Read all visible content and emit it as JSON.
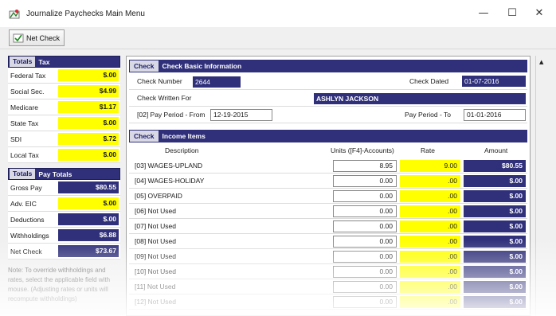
{
  "window": {
    "title": "Journalize Paychecks Main Menu",
    "minimize": "—",
    "maximize": "☐",
    "close": "✕"
  },
  "toolbar": {
    "net_check_label": "Net Check"
  },
  "sidebar": {
    "tax_tab": "Totals",
    "tax_title": "Tax",
    "taxes": [
      {
        "name": "Federal Tax",
        "value": "$.00"
      },
      {
        "name": "Social Sec.",
        "value": "$4.99"
      },
      {
        "name": "Medicare",
        "value": "$1.17"
      },
      {
        "name": "State Tax",
        "value": "$.00"
      },
      {
        "name": "SDI",
        "value": "$.72"
      },
      {
        "name": "Local Tax",
        "value": "$.00"
      }
    ],
    "pay_tab": "Totals",
    "pay_title": "Pay Totals",
    "pay": [
      {
        "name": "Gross Pay",
        "value": "$80.55"
      },
      {
        "name": "Adv. EIC",
        "value": "$.00"
      },
      {
        "name": "Deductions",
        "value": "$.00"
      },
      {
        "name": "Withholdings",
        "value": "$6.88"
      },
      {
        "name": "Net Check",
        "value": "$73.67"
      }
    ],
    "note": "Note: To override withholdings and rates, select the applicable field with mouse. (Adjusting rates or units will recompute withholdings)"
  },
  "check_info": {
    "tab": "Check",
    "title": "Check Basic Information",
    "check_number_label": "Check Number",
    "check_number": "2644",
    "check_dated_label": "Check Dated",
    "check_dated": "01-07-2016",
    "written_for_label": "Check Written For",
    "written_for": "ASHLYN JACKSON",
    "pay_from_label": "[02] Pay Period - From",
    "pay_from": "12-19-2015",
    "pay_to_label": "Pay Period - To",
    "pay_to": "01-01-2016"
  },
  "income": {
    "tab": "Check",
    "title": "Income Items",
    "col_description": "Description",
    "col_units": "Units ([F4]-Accounts)",
    "col_rate": "Rate",
    "col_amount": "Amount",
    "rows": [
      {
        "desc": "[03] WAGES-UPLAND",
        "units": "8.95",
        "rate": "9.00",
        "amount": "$80.55"
      },
      {
        "desc": "[04] WAGES-HOLIDAY",
        "units": "0.00",
        "rate": ".00",
        "amount": "$.00"
      },
      {
        "desc": "[05] OVERPAID",
        "units": "0.00",
        "rate": ".00",
        "amount": "$.00"
      },
      {
        "desc": "[06] Not Used",
        "units": "0.00",
        "rate": ".00",
        "amount": "$.00"
      },
      {
        "desc": "[07] Not Used",
        "units": "0.00",
        "rate": ".00",
        "amount": "$.00"
      },
      {
        "desc": "[08] Not Used",
        "units": "0.00",
        "rate": ".00",
        "amount": "$.00"
      },
      {
        "desc": "[09] Not Used",
        "units": "0.00",
        "rate": ".00",
        "amount": "$.00"
      },
      {
        "desc": "[10] Not Used",
        "units": "0.00",
        "rate": ".00",
        "amount": "$.00"
      },
      {
        "desc": "[11] Not Used",
        "units": "0.00",
        "rate": ".00",
        "amount": "$.00"
      },
      {
        "desc": "[12] Not Used",
        "units": "0.00",
        "rate": ".00",
        "amount": "$.00"
      }
    ]
  }
}
